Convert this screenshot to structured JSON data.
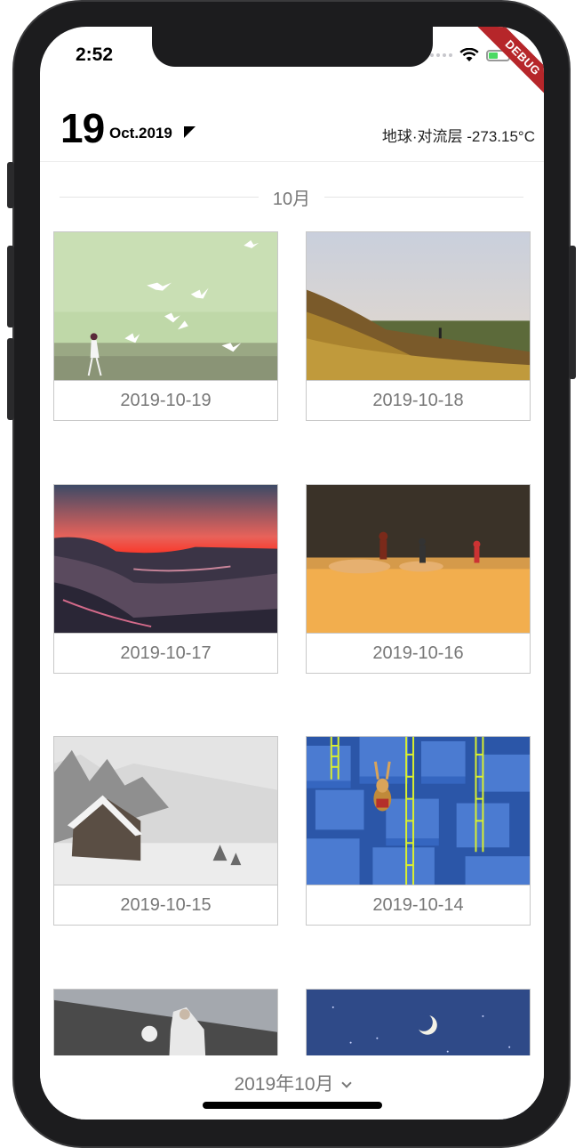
{
  "status_bar": {
    "time": "2:52",
    "debug_banner": "DEBUG"
  },
  "header": {
    "day": "19",
    "month_year": "Oct.2019",
    "weather": "地球·对流层 -273.15°C"
  },
  "section": {
    "title": "10月"
  },
  "cards": [
    {
      "date": "2019-10-19",
      "image": "meadow-birds"
    },
    {
      "date": "2019-10-18",
      "image": "hillside-sunset"
    },
    {
      "date": "2019-10-17",
      "image": "red-sky-coast"
    },
    {
      "date": "2019-10-16",
      "image": "desert-runners"
    },
    {
      "date": "2019-10-15",
      "image": "snow-cabin"
    },
    {
      "date": "2019-10-14",
      "image": "blue-blocks-rabbit"
    },
    {
      "date": "",
      "image": "nun-seaside"
    },
    {
      "date": "",
      "image": "night-moon"
    }
  ],
  "bottom_bar": {
    "selector_label": "2019年10月"
  }
}
